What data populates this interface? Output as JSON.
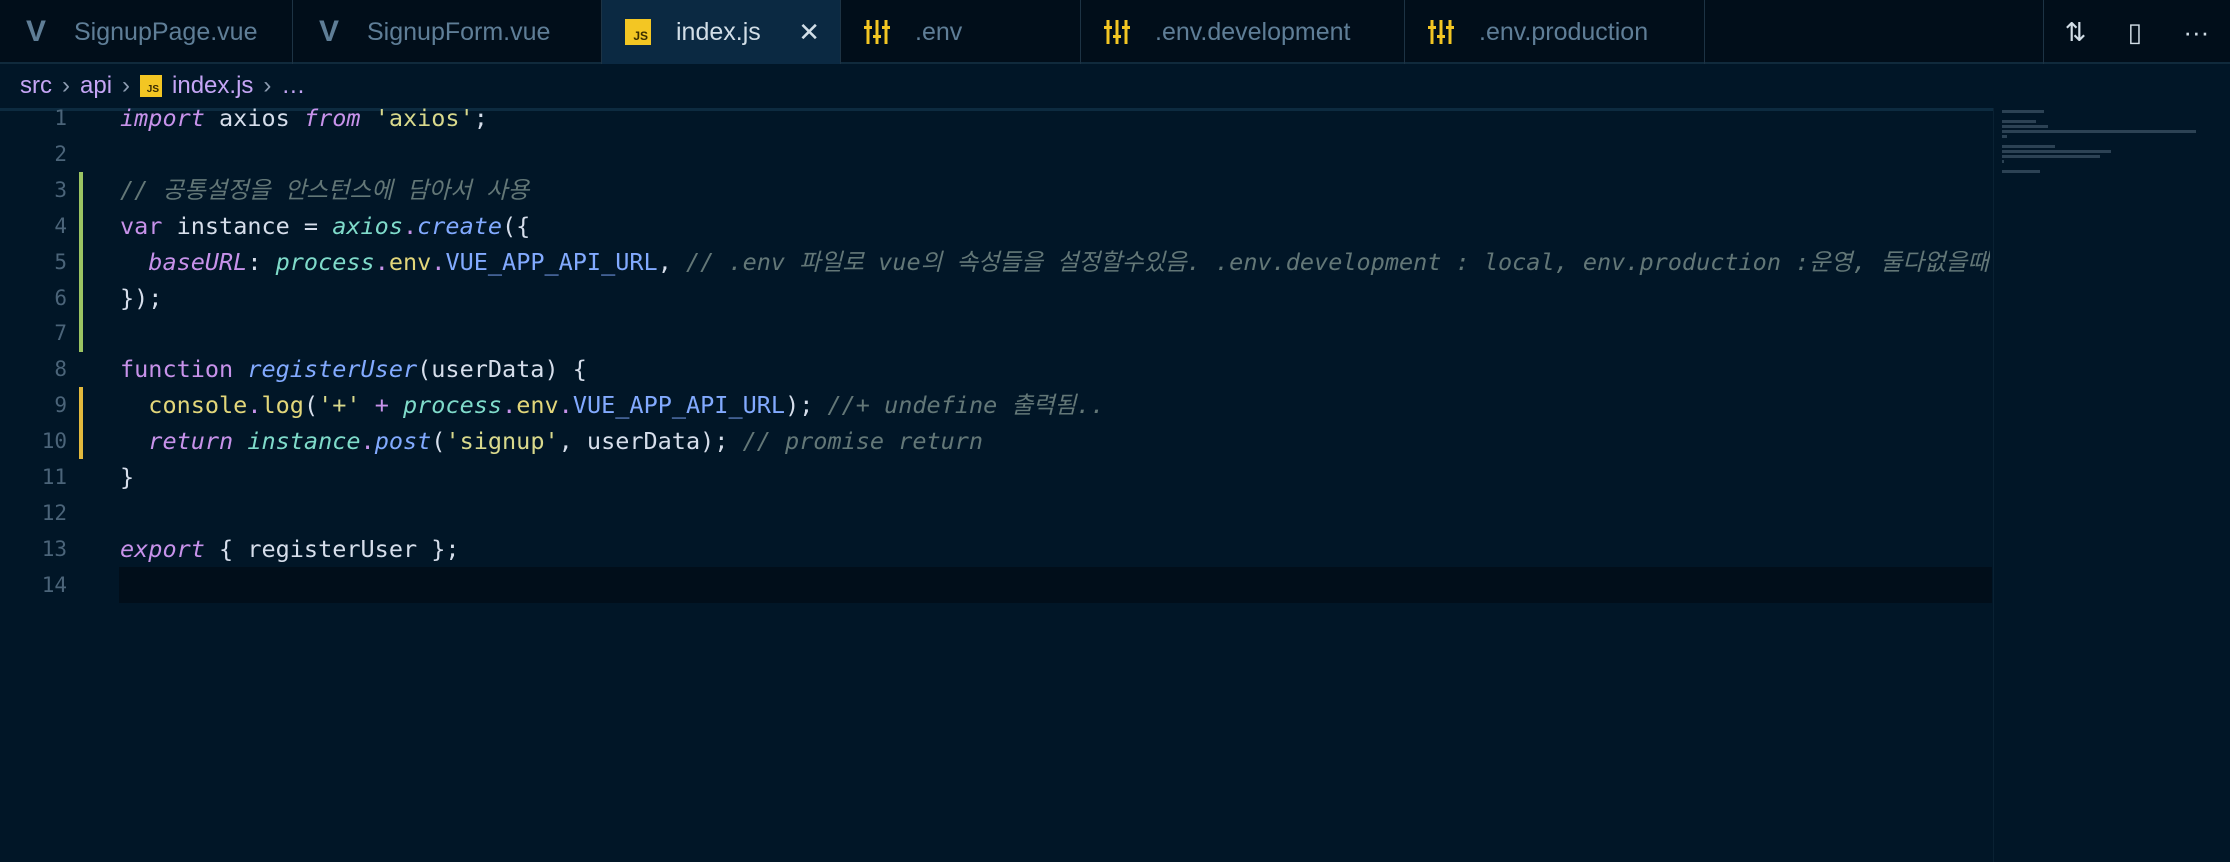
{
  "tabs": [
    {
      "label": "SignupPage.vue",
      "icon": "vue-icon"
    },
    {
      "label": "SignupForm.vue",
      "icon": "vue-icon"
    },
    {
      "label": "index.js",
      "icon": "js-icon",
      "active": true,
      "close": "✕"
    },
    {
      "label": ".env",
      "icon": "settings-icon"
    },
    {
      "label": ".env.development",
      "icon": "settings-icon"
    },
    {
      "label": ".env.production",
      "icon": "settings-icon"
    }
  ],
  "icon_text": {
    "js": "JS"
  },
  "actions": {
    "compare": "⇅",
    "split": "▯",
    "more": "···"
  },
  "breadcrumb": {
    "src": "src",
    "api": "api",
    "file": "index.js",
    "more": "…",
    "sep": "›"
  },
  "code": [
    [
      [
        "import",
        "ki"
      ],
      [
        " axios ",
        "p"
      ],
      [
        "from",
        "ki"
      ],
      [
        " ",
        "p"
      ],
      [
        "'axios'",
        "s"
      ],
      [
        ";",
        "p"
      ]
    ],
    [],
    [
      [
        "// 공통설정을 안스턴스에 담아서 사용",
        "c"
      ]
    ],
    [
      [
        "var",
        "k"
      ],
      [
        " instance = ",
        "p"
      ],
      [
        "axios",
        "t"
      ],
      [
        ".",
        "k"
      ],
      [
        "create",
        "f"
      ],
      [
        "({",
        "p"
      ]
    ],
    [
      [
        "  ",
        "p"
      ],
      [
        "baseURL",
        "ki"
      ],
      [
        ": ",
        "p"
      ],
      [
        "process",
        "t"
      ],
      [
        ".",
        "k"
      ],
      [
        "env",
        "y"
      ],
      [
        ".",
        "k"
      ],
      [
        "VUE_APP_API_URL",
        "b"
      ],
      [
        ", ",
        "p"
      ],
      [
        "// .env 파일로 vue의 속성들을 설정할수있음. .env.development : local, env.production :운영, 둘다없을때",
        "c"
      ]
    ],
    [
      [
        "});",
        "p"
      ]
    ],
    [],
    [
      [
        "function",
        "k"
      ],
      [
        " ",
        "p"
      ],
      [
        "registerUser",
        "ti"
      ],
      [
        "(userData) {",
        "p"
      ]
    ],
    [
      [
        "  ",
        "p"
      ],
      [
        "console",
        "y"
      ],
      [
        ".",
        "k"
      ],
      [
        "log",
        "y"
      ],
      [
        "(",
        "p"
      ],
      [
        "'+'",
        "s"
      ],
      [
        " + ",
        "k"
      ],
      [
        "process",
        "t"
      ],
      [
        ".",
        "k"
      ],
      [
        "env",
        "y"
      ],
      [
        ".",
        "k"
      ],
      [
        "VUE_APP_API_URL",
        "b"
      ],
      [
        "); ",
        "p"
      ],
      [
        "//+ undefine 출력됨..",
        "c"
      ]
    ],
    [
      [
        "  ",
        "p"
      ],
      [
        "return",
        "ki"
      ],
      [
        " ",
        "p"
      ],
      [
        "instance",
        "t"
      ],
      [
        ".",
        "k"
      ],
      [
        "post",
        "ti"
      ],
      [
        "(",
        "p"
      ],
      [
        "'signup'",
        "s"
      ],
      [
        ", userData); ",
        "p"
      ],
      [
        "// promise return",
        "c"
      ]
    ],
    [
      [
        "}",
        "p"
      ]
    ],
    [],
    [
      [
        "export",
        "ki"
      ],
      [
        " { registerUser };",
        "p"
      ]
    ],
    []
  ]
}
